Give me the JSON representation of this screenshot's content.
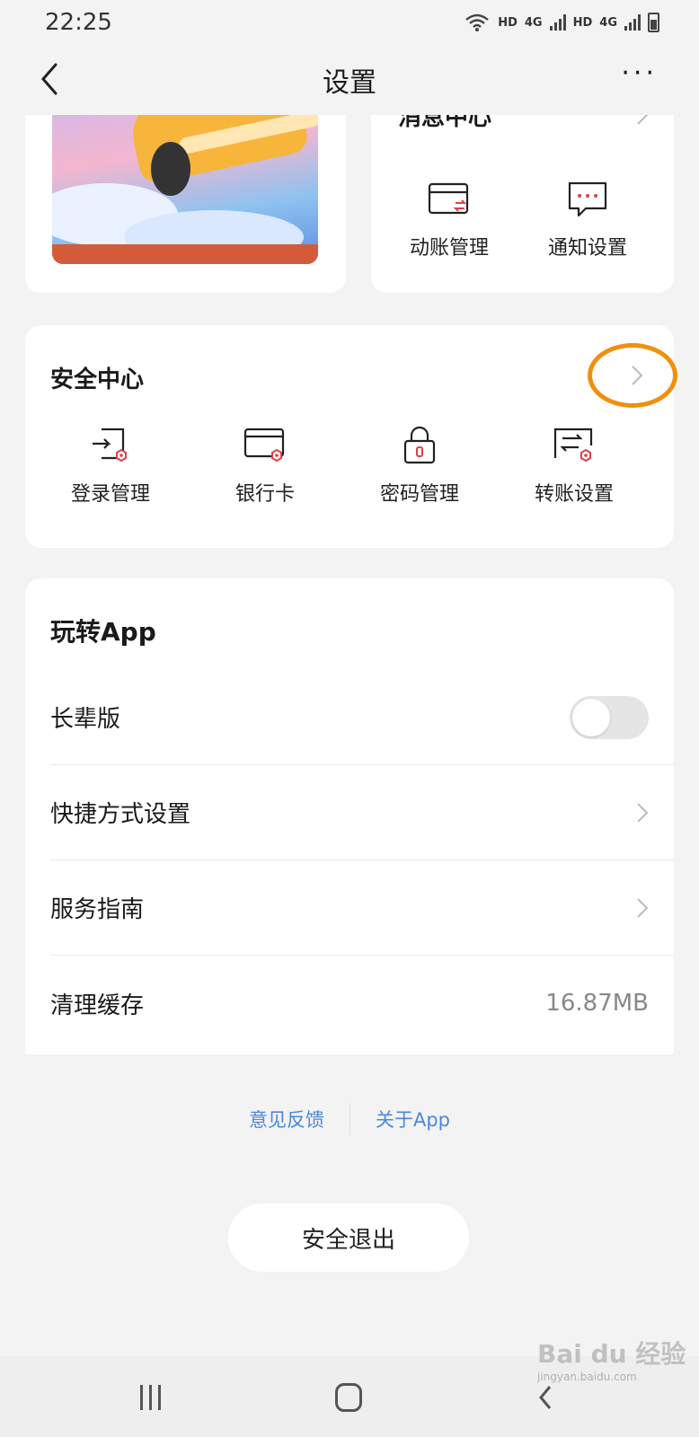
{
  "status_bar": {
    "time": "22:25",
    "network_labels": [
      "HD",
      "4G",
      "HD",
      "4G"
    ]
  },
  "header": {
    "title": "设置",
    "more_label": "···"
  },
  "message_center": {
    "title": "消息中心",
    "items": [
      {
        "label": "动账管理",
        "icon": "card-transfer-icon"
      },
      {
        "label": "通知设置",
        "icon": "chat-bubble-icon"
      }
    ]
  },
  "security_center": {
    "title": "安全中心",
    "items": [
      {
        "label": "登录管理",
        "icon": "login-icon"
      },
      {
        "label": "银行卡",
        "icon": "bank-card-icon"
      },
      {
        "label": "密码管理",
        "icon": "lock-icon"
      },
      {
        "label": "转账设置",
        "icon": "transfer-icon"
      }
    ]
  },
  "app_section": {
    "title": "玩转App",
    "rows": [
      {
        "label": "长辈版",
        "control": "toggle",
        "toggle_on": false
      },
      {
        "label": "快捷方式设置",
        "control": "chevron"
      },
      {
        "label": "服务指南",
        "control": "chevron"
      },
      {
        "label": "清理缓存",
        "control": "value",
        "value": "16.87MB"
      }
    ]
  },
  "footer_links": {
    "feedback": "意见反馈",
    "about": "关于App"
  },
  "logout_label": "安全退出",
  "watermark": {
    "brand": "Bai du 经验",
    "url": "jingyan.baidu.com"
  },
  "colors": {
    "accent_link": "#4a88d9",
    "highlight_ring": "#f0900e",
    "icon_red": "#e0404a"
  }
}
